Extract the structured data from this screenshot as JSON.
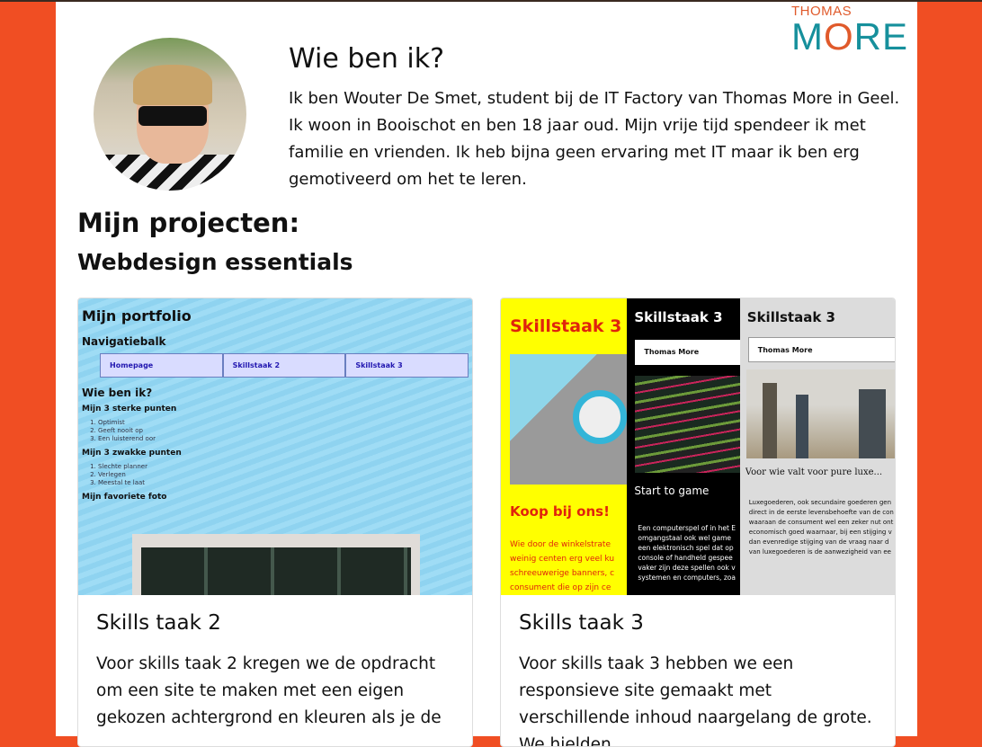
{
  "logo": {
    "top": "THOMAS",
    "main_pre": "M",
    "main_o": "O",
    "main_post": "RE"
  },
  "about": {
    "title": "Wie ben ik?",
    "text": "Ik ben Wouter De Smet, student bij de IT Factory van Thomas More in Geel. Ik woon in Booischot en ben 18 jaar oud. Mijn vrije tijd spendeer ik met familie en vrienden. Ik heb bijna geen ervaring met IT maar ik ben erg gemotiveerd om het te leren."
  },
  "projects": {
    "title": "Mijn projecten:",
    "subtitle": "Webdesign essentials"
  },
  "cards": [
    {
      "title": "Skills taak 2",
      "text": "Voor skills taak 2 kregen we de opdracht om een site te maken met een eigen gekozen achtergrond en kleuren als je de",
      "thumb": {
        "h1": "Mijn portfolio",
        "nav_title": "Navigatiebalk",
        "nav": [
          "Homepage",
          "Skillstaak 2",
          "Skillstaak 3"
        ],
        "who": "Wie ben ik?",
        "strong_title": "Mijn 3 sterke punten",
        "strong": [
          "Optimist",
          "Geeft nooit op",
          "Een luisterend oor"
        ],
        "weak_title": "Mijn 3 zwakke punten",
        "weak": [
          "Slechte planner",
          "Verlegen",
          "Meestal te laat"
        ],
        "photo_title": "Mijn favoriete foto"
      }
    },
    {
      "title": "Skills taak 3",
      "text": "Voor skills taak 3 hebben we een responsieve site gemaakt met verschillende inhoud naargelang de grote. We hielden",
      "thumb": {
        "a_title": "Skillstaak 3",
        "a_head": "Koop bij ons!",
        "a_text": [
          "Wie door de winkelstrate",
          "weinig centen erg veel ku",
          "schreeuwerige banners, c",
          "consument die op zijn ce"
        ],
        "b_title": "Skillstaak 3",
        "b_nav": "Thomas More",
        "b_head": "Start to game",
        "b_text": [
          "Een computerspel of in het E",
          "omgangstaal ook wel game",
          "een elektronisch spel dat op",
          "console of handheld gespee",
          "vaker zijn deze spellen ook v",
          "systemen en computers, zoa"
        ],
        "c_title": "Skillstaak 3",
        "c_nav": "Thomas More",
        "c_head": "Voor wie valt voor pure luxe...",
        "c_text": [
          "Luxegoederen, ook secundaire goederen gen",
          "direct in de eerste levensbehoefte van de con",
          "waaraan de consument wel een zeker nut ont",
          "economisch goed waarnaar, bij een stijging v",
          "dan evenredige stijging van de vraag naar d",
          "van luxegoederen is de aanwezigheid van ee"
        ]
      }
    }
  ]
}
